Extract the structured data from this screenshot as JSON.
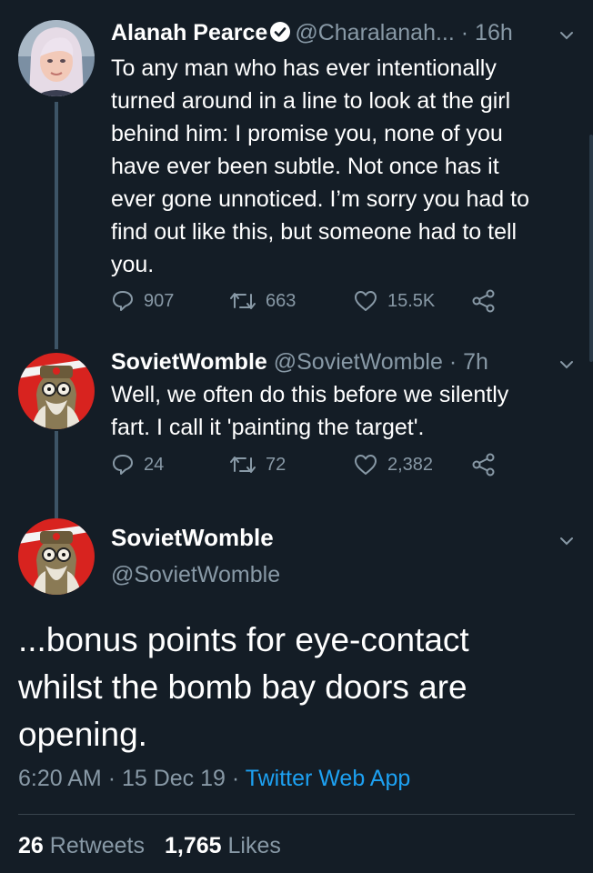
{
  "tweet1": {
    "name": "Alanah Pearce",
    "handle": "@Charalanah...",
    "separator": "·",
    "time": "16h",
    "lines": [
      "To any man who has ever intentionally",
      "turned around in a line to look at the girl",
      "behind him: I promise you, none of you",
      "have ever been subtle. Not once has it",
      "ever gone unnoticed. I’m sorry you had to",
      "find out like this, but someone had to tell",
      "you."
    ],
    "replies": "907",
    "retweets": "663",
    "likes": "15.5K"
  },
  "tweet2": {
    "name": "SovietWomble",
    "handle": "@SovietWomble",
    "separator": "·",
    "time": "7h",
    "lines": [
      "Well, we often do this before we silently",
      "fart. I call it 'painting the target'."
    ],
    "replies": "24",
    "retweets": "72",
    "likes": "2,382"
  },
  "main": {
    "name": "SovietWomble",
    "handle": "@SovietWomble",
    "lines": [
      "...bonus points for eye-contact",
      "whilst the bomb bay doors are",
      "opening."
    ],
    "time": "6:20 AM",
    "sep1": "·",
    "date": "15 Dec 19",
    "sep2": "·",
    "app": "Twitter Web App",
    "retweet_count": "26",
    "retweet_label": "Retweets",
    "like_count": "1,765",
    "like_label": "Likes"
  },
  "colors": {
    "background": "#141d26",
    "secondary_text": "#8899a6",
    "link": "#1da1f2",
    "thread_line": "#3d5466"
  },
  "icons": [
    "verified-icon",
    "chevron-down-icon",
    "reply-icon",
    "retweet-icon",
    "like-icon",
    "share-icon"
  ]
}
